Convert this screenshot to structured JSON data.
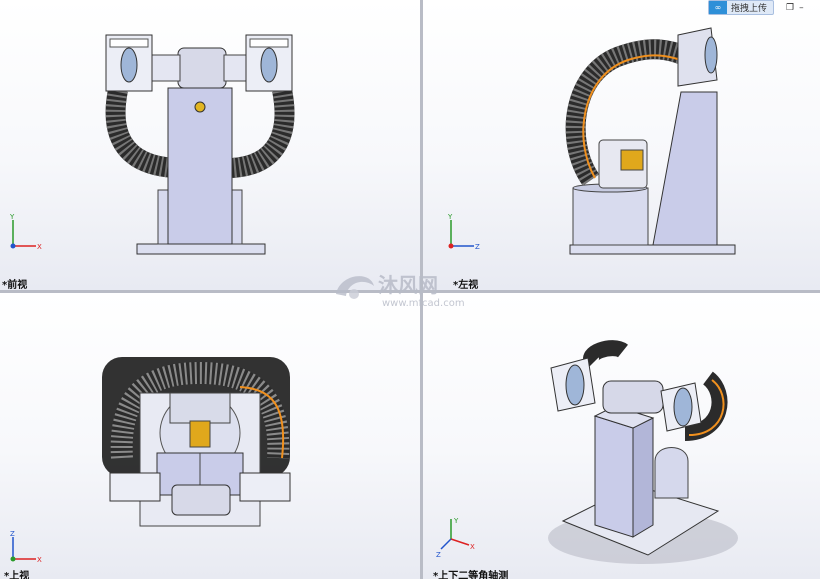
{
  "toolbar": {
    "buttons": [
      "zoom-to-fit-icon",
      "zoom-to-area-icon",
      "previous-view-icon",
      "section-view-icon",
      "dynamic-annotation-icon",
      "view-orientation-icon",
      "display-style-icon",
      "hide-show-icon",
      "edit-appearance-icon",
      "apply-scene-icon",
      "view-settings-icon"
    ]
  },
  "upload": {
    "label": "拖拽上传"
  },
  "viewports": {
    "front": {
      "label": "*前视"
    },
    "left": {
      "label": "*左视"
    },
    "top": {
      "label": "*上视"
    },
    "iso": {
      "label": "*上下二等角轴测"
    }
  },
  "triad": {
    "x": "X",
    "y": "Y",
    "z": "Z"
  },
  "watermark": {
    "brand": "沐风网",
    "url": "www.mfcad.com"
  },
  "colors": {
    "accent": "#f0901e",
    "steel": "#c8cce8",
    "hose": "#333333",
    "motor": "#e0a81c"
  }
}
